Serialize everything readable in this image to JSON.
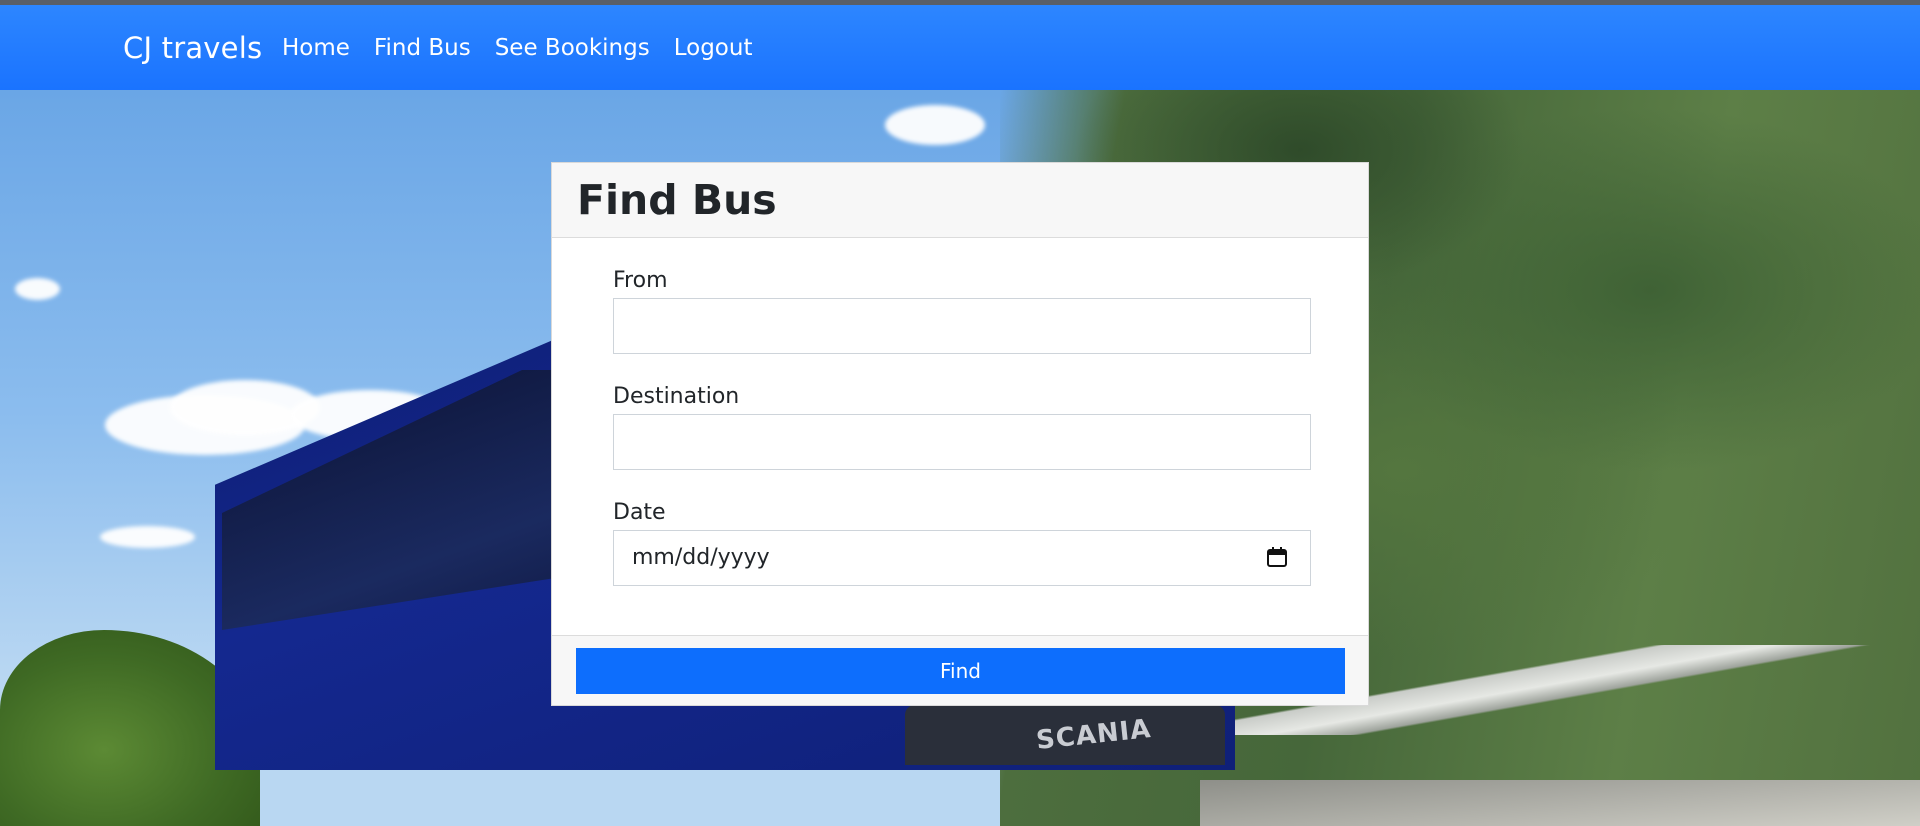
{
  "navbar": {
    "brand": "CJ travels",
    "links": [
      "Home",
      "Find Bus",
      "See Bookings",
      "Logout"
    ]
  },
  "background": {
    "bus_badge_text": "SCANIA"
  },
  "form": {
    "title": "Find Bus",
    "from_label": "From",
    "from_value": "",
    "destination_label": "Destination",
    "destination_value": "",
    "date_label": "Date",
    "date_placeholder": "mm/dd/yyyy",
    "submit_label": "Find"
  },
  "colors": {
    "navbar": "#1a73ff",
    "button": "#0d6efd"
  },
  "icons": {
    "date": "calendar-icon"
  }
}
